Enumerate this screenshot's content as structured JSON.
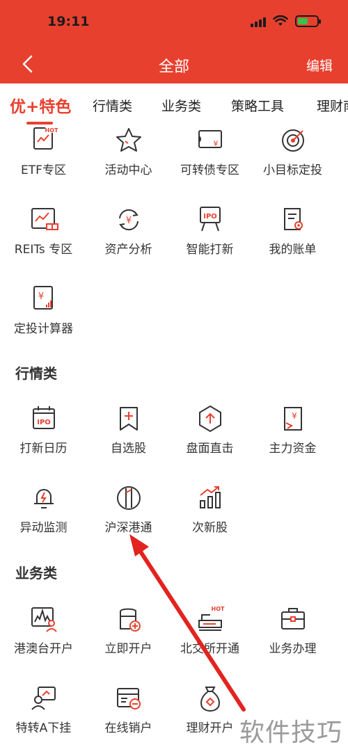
{
  "status": {
    "time": "19:11"
  },
  "nav": {
    "title": "全部",
    "edit_label": "编辑"
  },
  "tabs": [
    "优+特色",
    "行情类",
    "业务类",
    "策略工具",
    "理财南"
  ],
  "featured": {
    "items": [
      {
        "label": "ETF专区",
        "icon": "etf-hot-icon"
      },
      {
        "label": "活动中心",
        "icon": "star-icon"
      },
      {
        "label": "可转债专区",
        "icon": "bond-ticket-icon"
      },
      {
        "label": "小目标定投",
        "icon": "target-icon"
      },
      {
        "label": "REITs 专区",
        "icon": "reits-icon"
      },
      {
        "label": "资产分析",
        "icon": "asset-cycle-icon"
      },
      {
        "label": "智能打新",
        "icon": "ipo-board-icon"
      },
      {
        "label": "我的账单",
        "icon": "bill-scroll-icon"
      },
      {
        "label": "定投计算器",
        "icon": "calculator-icon"
      }
    ]
  },
  "market": {
    "title": "行情类",
    "items": [
      {
        "label": "打新日历",
        "icon": "ipo-calendar-icon"
      },
      {
        "label": "自选股",
        "icon": "bookmark-plus-icon"
      },
      {
        "label": "盘面直击",
        "icon": "hexagon-arrow-icon"
      },
      {
        "label": "主力资金",
        "icon": "capital-flow-icon"
      },
      {
        "label": "异动监测",
        "icon": "bell-alert-icon"
      },
      {
        "label": "沪深港通",
        "icon": "connect-circle-icon"
      },
      {
        "label": "次新股",
        "icon": "rising-bars-icon"
      }
    ]
  },
  "business": {
    "title": "业务类",
    "items": [
      {
        "label": "港澳台开户",
        "icon": "hk-account-icon"
      },
      {
        "label": "立即开户",
        "icon": "open-account-icon"
      },
      {
        "label": "北交所开通",
        "icon": "bse-hot-icon"
      },
      {
        "label": "业务办理",
        "icon": "briefcase-icon"
      },
      {
        "label": "特转A下挂",
        "icon": "transfer-user-icon"
      },
      {
        "label": "在线销户",
        "icon": "close-account-icon"
      },
      {
        "label": "理财开户",
        "icon": "money-bag-icon"
      }
    ]
  },
  "watermark": "软件技巧",
  "colors": {
    "brand": "#e8402f",
    "text": "#333333"
  }
}
